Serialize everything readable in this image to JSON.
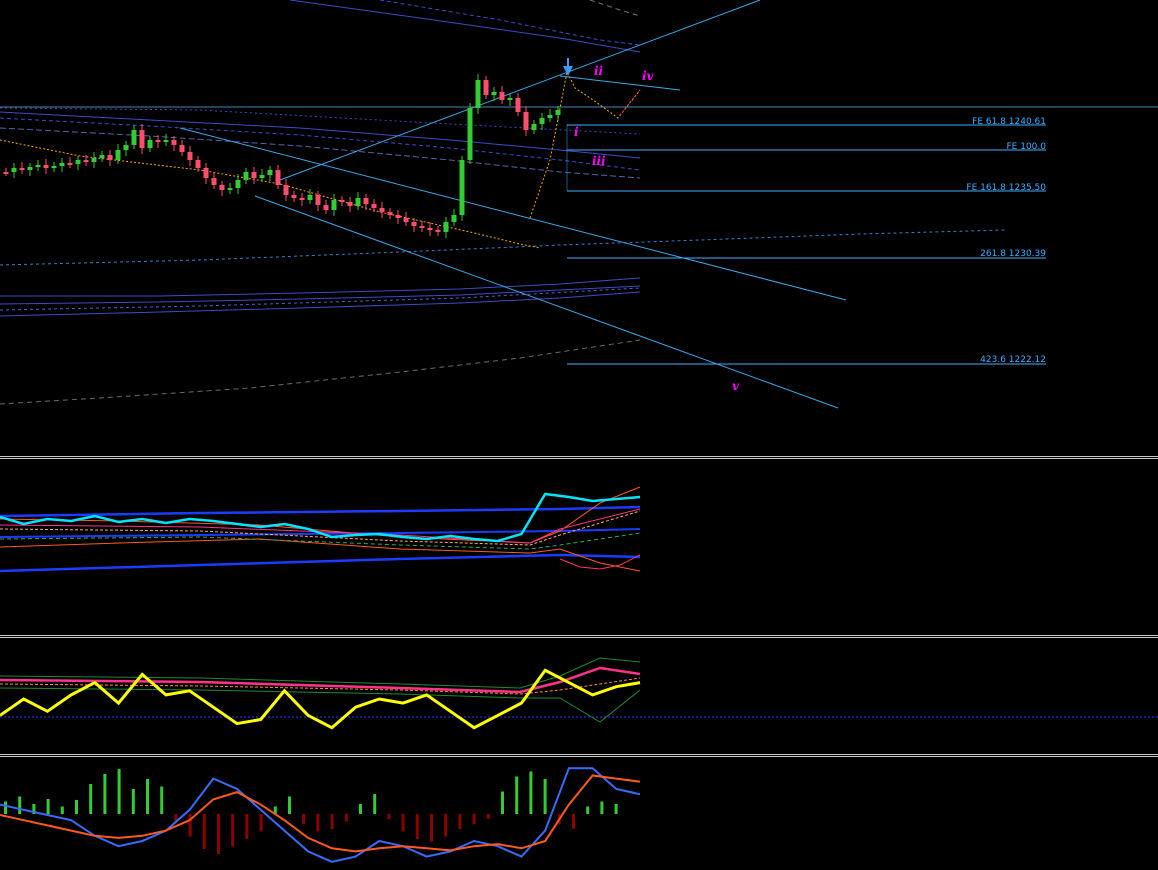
{
  "colors": {
    "background": "#000000",
    "bull_candle": "#32cd32",
    "bear_candle": "#ff4d6d",
    "channel": "#3aa8e8",
    "fib_line": "#3ab0ff",
    "wave_label": "#ff00ff",
    "osc1_main": "#00e5ff",
    "osc2_main": "#ffff00",
    "hist_pos": "#32cd32",
    "hist_neg": "#8b0000",
    "signal_fast": "#3a6bff",
    "signal_slow": "#ff5a1a"
  },
  "fib_levels": [
    {
      "label": "FE 61.8 1240.61",
      "value": 1240.61
    },
    {
      "label": "FE 100.0",
      "value": 1239.0
    },
    {
      "label": "FE 161.8 1235.50",
      "value": 1235.5
    },
    {
      "label": "261.8 1230.39",
      "value": 1230.39
    },
    {
      "label": "423.6 1222.12",
      "value": 1222.12
    }
  ],
  "wave_labels": [
    "i",
    "ii",
    "iii",
    "iv",
    "v"
  ],
  "chart_data": [
    {
      "type": "line",
      "pane": "price",
      "series": [
        {
          "values": [
            1243.0,
            1242.8,
            1242.4,
            1242.0,
            1241.5,
            1241.2,
            1240.8,
            1240.5
          ]
        },
        {
          "values": [
            1241.5,
            1241.0,
            1240.6,
            1240.2,
            1239.9,
            1239.5,
            1239.3,
            1239.1
          ]
        }
      ],
      "levels": [
        1240.61,
        1239.0,
        1235.5,
        1230.39,
        1222.12
      ]
    },
    {
      "type": "line",
      "pane": "oscillator-1",
      "series": [
        {
          "values": [
            0.62,
            0.55,
            0.6,
            0.58,
            0.63,
            0.57,
            0.6,
            0.56,
            0.6,
            0.58,
            0.55,
            0.52,
            0.55,
            0.5,
            0.42,
            0.44,
            0.45,
            0.42,
            0.4,
            0.43,
            0.4,
            0.38,
            0.45,
            0.85,
            0.82,
            0.78,
            0.8,
            0.82
          ]
        }
      ]
    },
    {
      "type": "line",
      "pane": "oscillator-2",
      "series": [
        {
          "values": [
            0.3,
            0.5,
            0.35,
            0.55,
            0.7,
            0.45,
            0.8,
            0.55,
            0.6,
            0.4,
            0.2,
            0.25,
            0.6,
            0.3,
            0.15,
            0.4,
            0.5,
            0.45,
            0.55,
            0.35,
            0.15,
            0.3,
            0.45,
            0.85,
            0.7,
            0.55,
            0.65,
            0.7
          ]
        }
      ]
    },
    {
      "type": "bar",
      "pane": "oscillator-3",
      "values": [
        0.25,
        0.35,
        0.2,
        0.3,
        0.15,
        0.28,
        0.6,
        0.8,
        0.9,
        0.5,
        0.7,
        0.55,
        -0.15,
        -0.45,
        -0.7,
        -0.8,
        -0.65,
        -0.5,
        -0.35,
        0.15,
        0.35,
        -0.2,
        -0.35,
        -0.3,
        -0.15,
        0.2,
        0.4,
        -0.1,
        -0.35,
        -0.5,
        -0.55,
        -0.45,
        -0.3,
        -0.2,
        -0.1,
        0.45,
        0.75,
        0.85,
        0.7,
        -0.2,
        -0.3,
        0.15,
        0.25,
        0.2
      ],
      "series": [
        {
          "values": [
            0.6,
            0.55,
            0.5,
            0.45,
            0.3,
            0.2,
            0.25,
            0.35,
            0.55,
            0.85,
            0.75,
            0.55,
            0.35,
            0.15,
            0.05,
            0.1,
            0.25,
            0.2,
            0.1,
            0.15,
            0.25,
            0.2,
            0.1,
            0.35,
            0.95,
            0.95,
            0.75,
            0.7
          ]
        },
        {
          "values": [
            0.5,
            0.45,
            0.4,
            0.35,
            0.3,
            0.28,
            0.3,
            0.35,
            0.45,
            0.65,
            0.72,
            0.6,
            0.45,
            0.28,
            0.18,
            0.15,
            0.18,
            0.2,
            0.18,
            0.16,
            0.2,
            0.22,
            0.18,
            0.25,
            0.6,
            0.88,
            0.85,
            0.82
          ]
        }
      ]
    }
  ]
}
